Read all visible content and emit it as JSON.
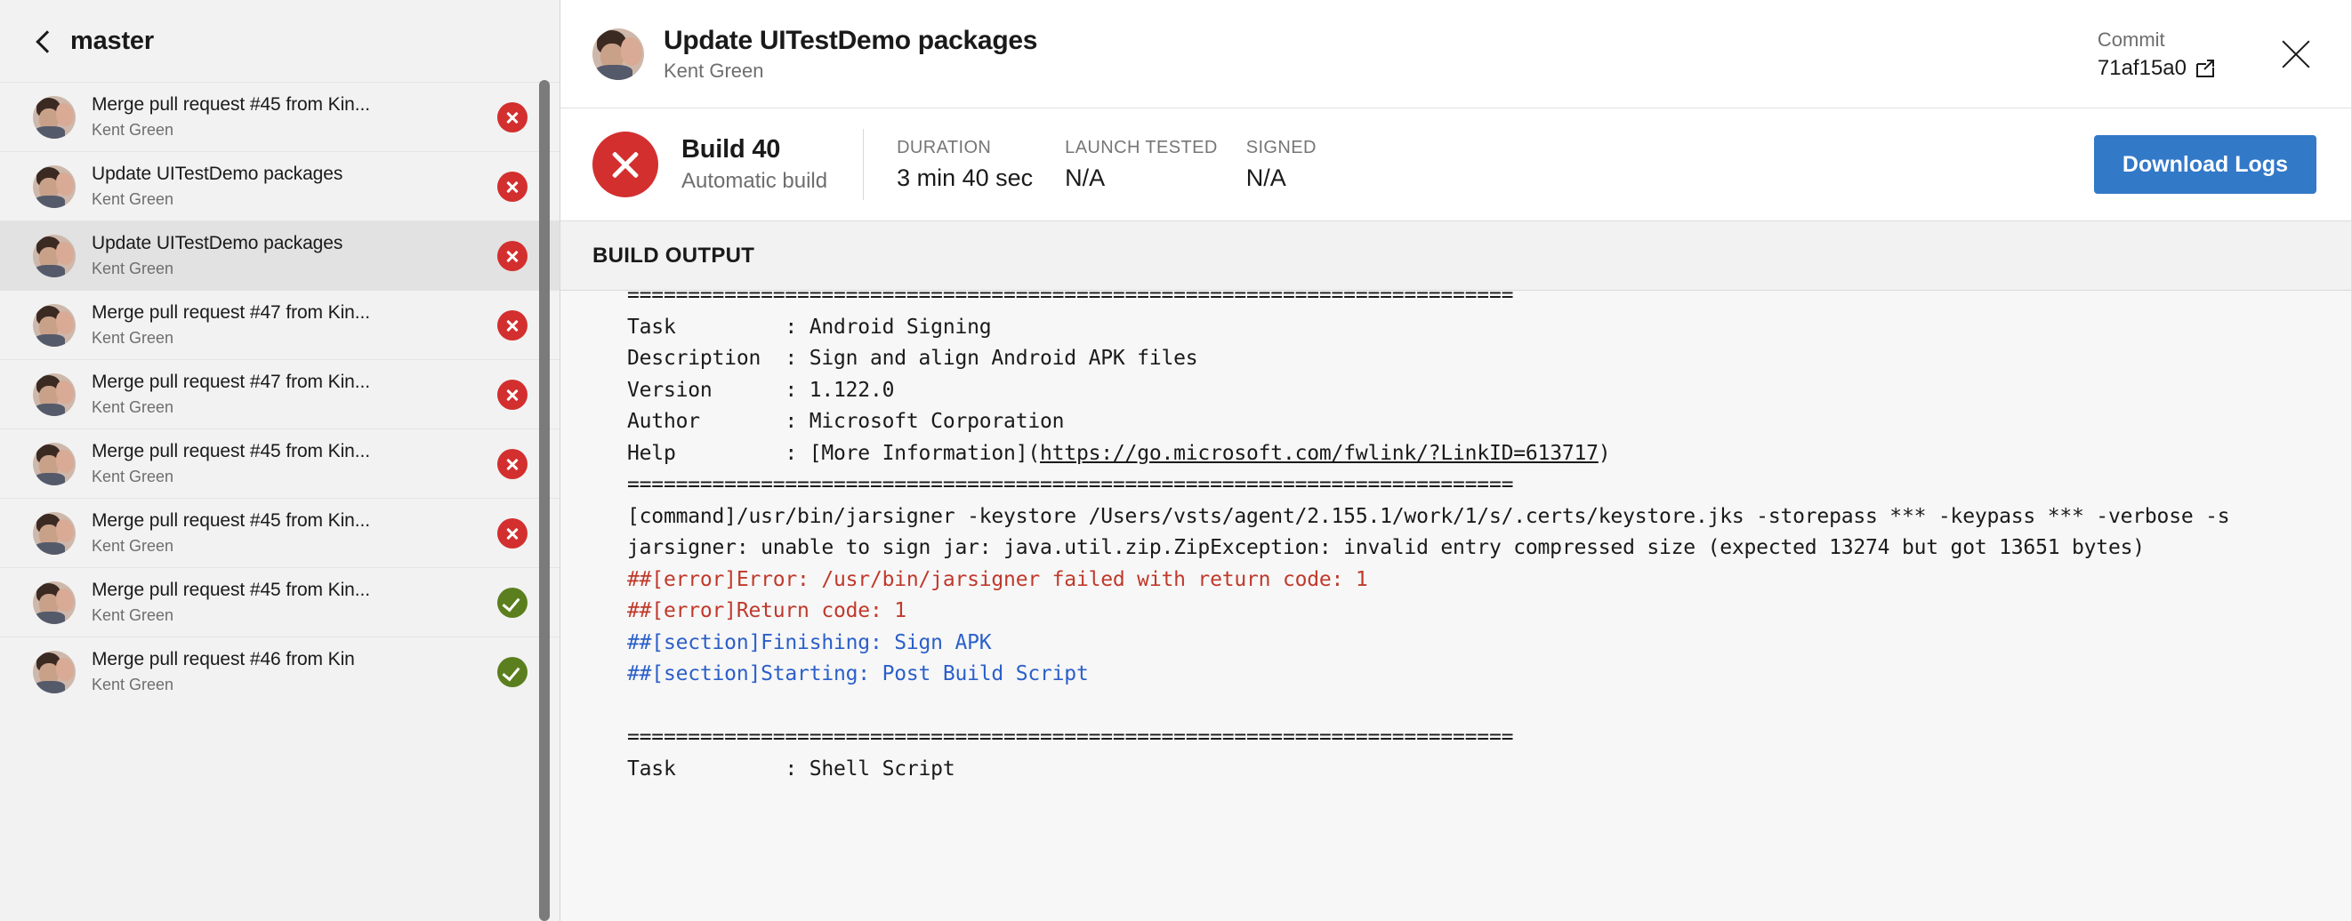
{
  "sidebar": {
    "branch_label": "master",
    "back_icon": "chevron-left-icon",
    "commits": [
      {
        "title": "Merge pull request #45 from Kin...",
        "author": "Kent Green",
        "status": "failed"
      },
      {
        "title": "Update UITestDemo packages",
        "author": "Kent Green",
        "status": "failed"
      },
      {
        "title": "Update UITestDemo packages",
        "author": "Kent Green",
        "status": "failed",
        "selected": true
      },
      {
        "title": "Merge pull request #47 from Kin...",
        "author": "Kent Green",
        "status": "failed"
      },
      {
        "title": "Merge pull request #47 from Kin...",
        "author": "Kent Green",
        "status": "failed"
      },
      {
        "title": "Merge pull request #45 from Kin...",
        "author": "Kent Green",
        "status": "failed"
      },
      {
        "title": "Merge pull request #45 from Kin...",
        "author": "Kent Green",
        "status": "failed"
      },
      {
        "title": "Merge pull request #45 from Kin...",
        "author": "Kent Green",
        "status": "succeeded"
      },
      {
        "title": "Merge pull request #46 from Kin",
        "author": "Kent Green",
        "status": "succeeded"
      }
    ]
  },
  "header": {
    "title": "Update UITestDemo packages",
    "subtitle": "Kent Green",
    "commit_label": "Commit",
    "commit_hash": "71af15a0",
    "external_link_icon": "external-link-icon",
    "close_icon": "close-icon"
  },
  "build_summary": {
    "status": "failed",
    "status_icon": "error-circle-icon",
    "build_number": "Build 40",
    "build_kind": "Automatic build",
    "stats": [
      {
        "label": "DURATION",
        "value": "3 min 40 sec"
      },
      {
        "label": "LAUNCH TESTED",
        "value": "N/A"
      },
      {
        "label": "SIGNED",
        "value": "N/A"
      }
    ],
    "download_button": "Download Logs"
  },
  "build_output": {
    "section_title": "BUILD OUTPUT",
    "lines": [
      {
        "kind": "plain",
        "text": "========================================================================="
      },
      {
        "kind": "plain",
        "text": "Task         : Android Signing"
      },
      {
        "kind": "plain",
        "text": "Description  : Sign and align Android APK files"
      },
      {
        "kind": "plain",
        "text": "Version      : 1.122.0"
      },
      {
        "kind": "plain",
        "text": "Author       : Microsoft Corporation"
      },
      {
        "kind": "link",
        "prefix": "Help         : [More Information](",
        "link": "https://go.microsoft.com/fwlink/?LinkID=613717",
        "suffix": ")"
      },
      {
        "kind": "plain",
        "text": "========================================================================="
      },
      {
        "kind": "plain",
        "text": "[command]/usr/bin/jarsigner -keystore /Users/vsts/agent/2.155.1/work/1/s/.certs/keystore.jks -storepass *** -keypass *** -verbose -s"
      },
      {
        "kind": "plain",
        "text": "jarsigner: unable to sign jar: java.util.zip.ZipException: invalid entry compressed size (expected 13274 but got 13651 bytes)"
      },
      {
        "kind": "error",
        "text": "##[error]Error: /usr/bin/jarsigner failed with return code: 1"
      },
      {
        "kind": "error",
        "text": "##[error]Return code: 1"
      },
      {
        "kind": "section",
        "text": "##[section]Finishing: Sign APK"
      },
      {
        "kind": "section",
        "text": "##[section]Starting: Post Build Script"
      },
      {
        "kind": "plain",
        "text": ""
      },
      {
        "kind": "plain",
        "text": "========================================================================="
      },
      {
        "kind": "plain",
        "text": "Task         : Shell Script"
      }
    ]
  },
  "colors": {
    "accent_blue": "#3279c8",
    "error_red": "#d32f2f",
    "success_green": "#5b7f1e",
    "log_error_text": "#c0392b",
    "log_section_text": "#2b5fc9"
  }
}
